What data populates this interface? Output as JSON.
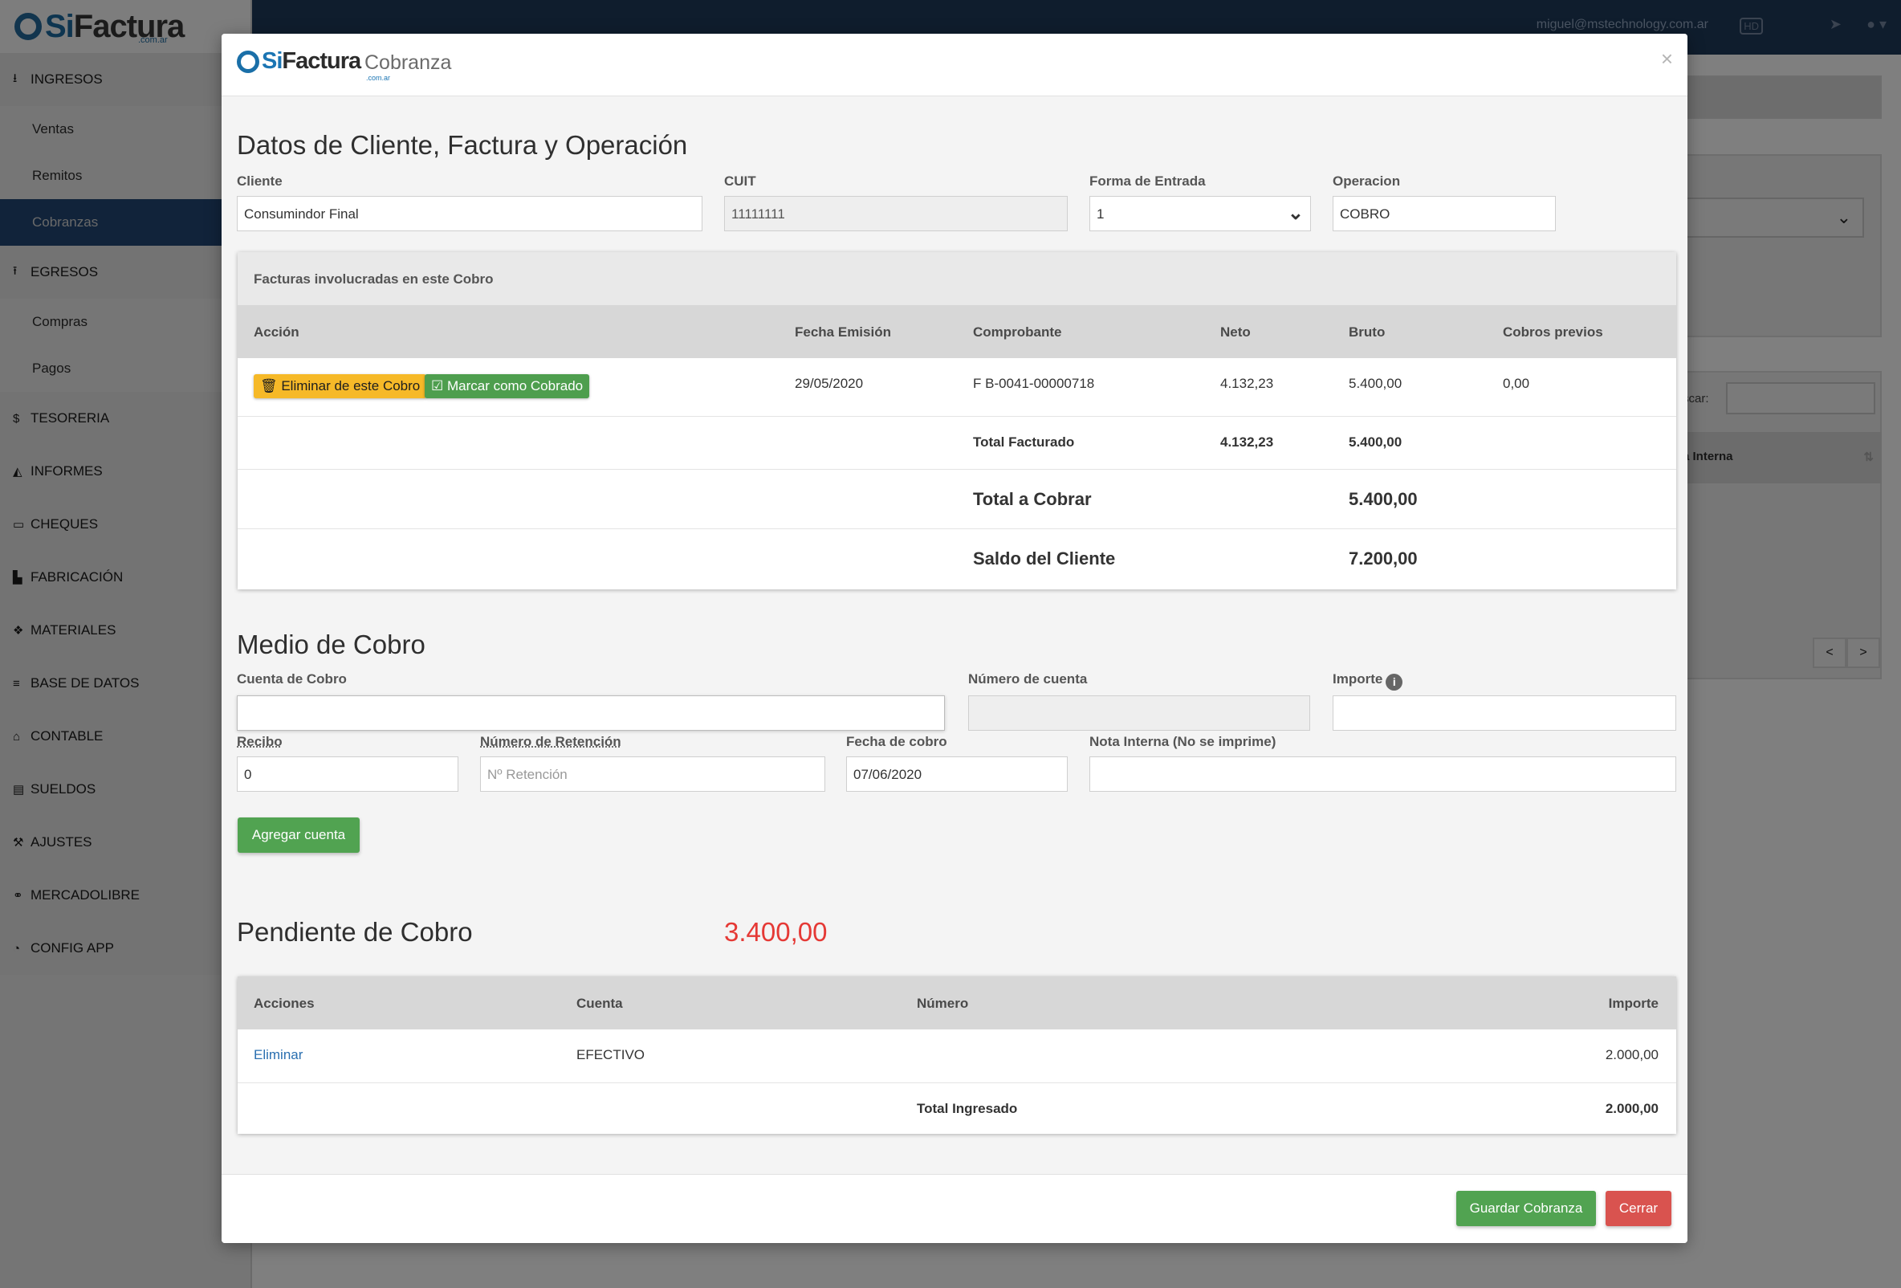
{
  "app": {
    "logo_si": "Si",
    "logo_factura": "Factura",
    "logo_sub": ".com.ar",
    "user_email": "miguel@mstechnology.com.ar",
    "hd_icon": "HD",
    "search_label": "scar:",
    "table_header": "a Interna",
    "pager_prev": "<",
    "pager_next": ">"
  },
  "sidebar": {
    "ingresos": "INGRESOS",
    "ventas": "Ventas",
    "remitos": "Remitos",
    "cobranzas": "Cobranzas",
    "egresos": "EGRESOS",
    "compras": "Compras",
    "pagos": "Pagos",
    "tesoreria": "TESORERIA",
    "informes": "INFORMES",
    "cheques": "CHEQUES",
    "fabricacion": "FABRICACIÓN",
    "materiales": "MATERIALES",
    "base_datos": "BASE DE DATOS",
    "contable": "CONTABLE",
    "sueldos": "SUELDOS",
    "ajustes": "AJUSTES",
    "mercadolibre": "MERCADOLIBRE",
    "config_app": "CONFIG APP"
  },
  "modal": {
    "title": "Cobranza",
    "close": "×",
    "section1_title": "Datos de Cliente, Factura y Operación",
    "cliente_label": "Cliente",
    "cliente_value": "Consumindor Final",
    "cuit_label": "CUIT",
    "cuit_value": "11111111",
    "forma_label": "Forma de Entrada",
    "forma_value": "1",
    "operacion_label": "Operacion",
    "operacion_value": "COBRO",
    "facturas": {
      "caption": "Facturas involucradas en este Cobro",
      "headers": [
        "Acción",
        "Fecha Emisión",
        "Comprobante",
        "Neto",
        "Bruto",
        "Cobros previos"
      ],
      "eliminar_btn": "Eliminar de este Cobro",
      "marcar_btn": "Marcar como Cobrado",
      "row": {
        "fecha": "29/05/2020",
        "comprobante": "F B-0041-00000718",
        "neto": "4.132,23",
        "bruto": "5.400,00",
        "cobros_previos": "0,00"
      },
      "total_facturado_label": "Total Facturado",
      "total_facturado_neto": "4.132,23",
      "total_facturado_bruto": "5.400,00",
      "total_cobrar_label": "Total a Cobrar",
      "total_cobrar_value": "5.400,00",
      "saldo_label": "Saldo del Cliente",
      "saldo_value": "7.200,00"
    },
    "section2_title": "Medio de Cobro",
    "cuenta_cobro_label": "Cuenta de Cobro",
    "cuenta_cobro_value": "",
    "numero_cuenta_label": "Número de cuenta",
    "numero_cuenta_value": "",
    "importe_label": "Importe",
    "importe_value": "",
    "recibo_label": "Recibo",
    "recibo_value": "0",
    "retencion_label": "Número de Retención",
    "retencion_placeholder": "Nº Retención",
    "fecha_cobro_label": "Fecha de cobro",
    "fecha_cobro_value": "07/06/2020",
    "nota_label": "Nota Interna (No se imprime)",
    "nota_value": "",
    "agregar_btn": "Agregar cuenta",
    "pendiente_label": "Pendiente de Cobro",
    "pendiente_value": "3.400,00",
    "pendiente_color": "#e53935",
    "cuentas": {
      "headers": [
        "Acciones",
        "Cuenta",
        "Número",
        "Importe"
      ],
      "row": {
        "accion": "Eliminar",
        "cuenta": "EFECTIVO",
        "numero": "",
        "importe": "2.000,00"
      },
      "total_label": "Total Ingresado",
      "total_value": "2.000,00"
    },
    "guardar_btn": "Guardar Cobranza",
    "cerrar_btn": "Cerrar"
  }
}
